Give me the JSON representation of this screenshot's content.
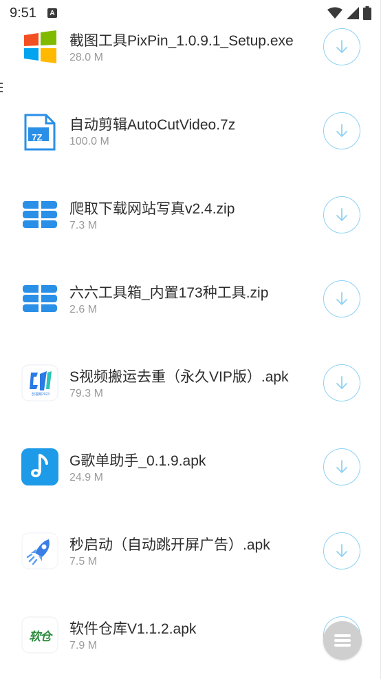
{
  "status_bar": {
    "time": "9:51",
    "notification_icon": "a-icon"
  },
  "files": [
    {
      "name": "截图工具PixPin_1.0.9.1_Setup.exe",
      "size": "28.0 M",
      "icon": "windows-icon"
    },
    {
      "name": "自动剪辑AutoCutVideo.7z",
      "size": "100.0 M",
      "icon": "7z-archive-icon"
    },
    {
      "name": "爬取下载网站写真v2.4.zip",
      "size": "7.3 M",
      "icon": "zip-archive-icon"
    },
    {
      "name": "六六工具箱_内置173种工具.zip",
      "size": "2.6 M",
      "icon": "zip-archive-icon"
    },
    {
      "name": "S视频搬运去重（永久VIP版）.apk",
      "size": "79.3 M",
      "icon": "video-app-icon"
    },
    {
      "name": "G歌单助手_0.1.9.apk",
      "size": "24.9 M",
      "icon": "music-note-icon"
    },
    {
      "name": "秒启动（自动跳开屏广告）.apk",
      "size": "7.5 M",
      "icon": "rocket-icon"
    },
    {
      "name": "软件仓库V1.1.2.apk",
      "size": "7.9 M",
      "icon": "software-store-icon"
    }
  ],
  "app_icon_labels": {
    "sevenz": "7Z",
    "video": "剪视频2023",
    "store": "软仓"
  },
  "colors": {
    "download_ring": "#8fd3f2",
    "accent_blue": "#2a8fe6",
    "fab": "#cfcfcf"
  }
}
